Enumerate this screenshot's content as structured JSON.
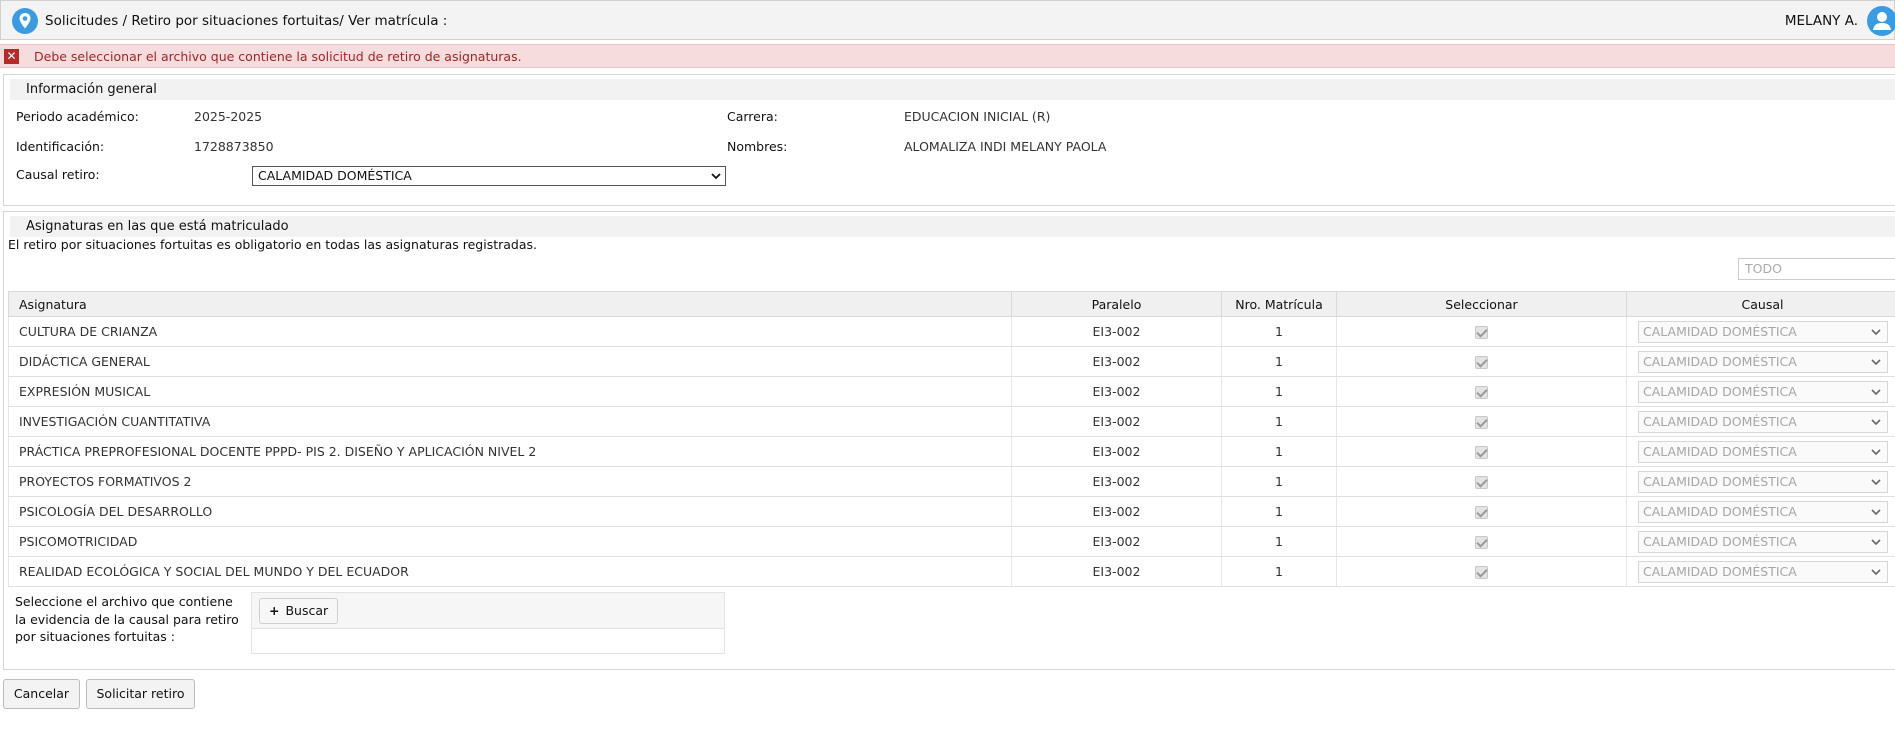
{
  "topbar": {
    "breadcrumb": "Solicitudes / Retiro por situaciones fortuitas/ Ver matrícula :",
    "user_name": "MELANY A."
  },
  "alert": {
    "message": "Debe seleccionar el archivo que contiene la solicitud de retiro de asignaturas."
  },
  "general": {
    "title": "Información general",
    "periodo_label": "Periodo académico:",
    "periodo_value": "2025-2025",
    "carrera_label": "Carrera:",
    "carrera_value": "EDUCACION INICIAL (R)",
    "identificacion_label": "Identificación:",
    "identificacion_value": "1728873850",
    "nombres_label": "Nombres:",
    "nombres_value": "ALOMALIZA INDI MELANY PAOLA",
    "causal_label": "Causal retiro:",
    "causal_value": "CALAMIDAD DOMÉSTICA"
  },
  "subjects": {
    "title": "Asignaturas en las que está matriculado",
    "note": "El retiro por situaciones fortuitas es obligatorio en todas las asignaturas registradas.",
    "filter_value": "TODO",
    "columns": [
      "Asignatura",
      "Paralelo",
      "Nro. Matrícula",
      "Seleccionar",
      "Causal"
    ],
    "rows": [
      {
        "asignatura": "CULTURA DE CRIANZA",
        "paralelo": "EI3-002",
        "matricula": "1",
        "causal": "CALAMIDAD DOMÉSTICA"
      },
      {
        "asignatura": "DIDÁCTICA GENERAL",
        "paralelo": "EI3-002",
        "matricula": "1",
        "causal": "CALAMIDAD DOMÉSTICA"
      },
      {
        "asignatura": "EXPRESIÓN MUSICAL",
        "paralelo": "EI3-002",
        "matricula": "1",
        "causal": "CALAMIDAD DOMÉSTICA"
      },
      {
        "asignatura": "INVESTIGACIÓN CUANTITATIVA",
        "paralelo": "EI3-002",
        "matricula": "1",
        "causal": "CALAMIDAD DOMÉSTICA"
      },
      {
        "asignatura": "PRÁCTICA PREPROFESIONAL DOCENTE PPPD- PIS 2. DISEÑO Y APLICACIÓN NIVEL 2",
        "paralelo": "EI3-002",
        "matricula": "1",
        "causal": "CALAMIDAD DOMÉSTICA"
      },
      {
        "asignatura": "PROYECTOS FORMATIVOS 2",
        "paralelo": "EI3-002",
        "matricula": "1",
        "causal": "CALAMIDAD DOMÉSTICA"
      },
      {
        "asignatura": "PSICOLOGÍA DEL DESARROLLO",
        "paralelo": "EI3-002",
        "matricula": "1",
        "causal": "CALAMIDAD DOMÉSTICA"
      },
      {
        "asignatura": "PSICOMOTRICIDAD",
        "paralelo": "EI3-002",
        "matricula": "1",
        "causal": "CALAMIDAD DOMÉSTICA"
      },
      {
        "asignatura": "REALIDAD ECOLÓGICA Y SOCIAL DEL MUNDO Y DEL ECUADOR",
        "paralelo": "EI3-002",
        "matricula": "1",
        "causal": "CALAMIDAD DOMÉSTICA"
      }
    ]
  },
  "file": {
    "label": "Seleccione el archivo que contiene la evidencia de la causal para retiro por situaciones fortuitas :",
    "button_label": "Buscar"
  },
  "actions": {
    "cancel_label": "Cancelar",
    "submit_label": "Solicitar retiro"
  },
  "colors": {
    "alert_bg": "#f6dcdc",
    "alert_text": "#a02626",
    "accent_blue": "#3b9be0"
  }
}
